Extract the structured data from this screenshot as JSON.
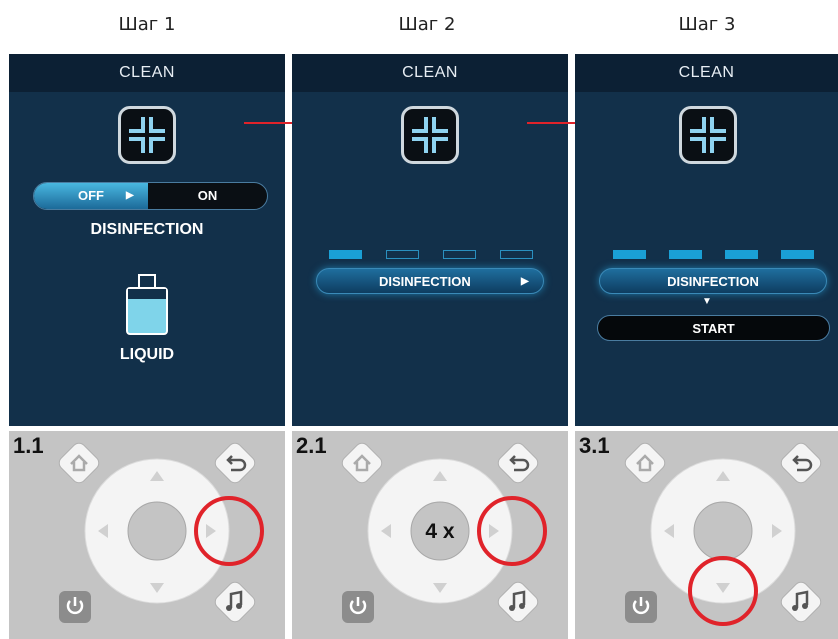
{
  "steps": [
    {
      "title": "Шаг 1",
      "screen_header": "CLEAN",
      "toggle": {
        "off_label": "OFF",
        "on_label": "ON"
      },
      "label_disinfection": "DISINFECTION",
      "label_liquid": "LIQUID",
      "remote_label": "1.1"
    },
    {
      "title": "Шаг 2",
      "screen_header": "CLEAN",
      "segments_filled": 1,
      "segments_total": 4,
      "pill_label": "DISINFECTION",
      "remote_label": "2.1",
      "center_text": "4 x"
    },
    {
      "title": "Шаг 3",
      "screen_header": "CLEAN",
      "segments_filled": 4,
      "segments_total": 4,
      "pill_label": "DISINFECTION",
      "start_label": "START",
      "remote_label": "3.1"
    }
  ],
  "colors": {
    "screen_bg": "#12304a",
    "accent_blue": "#1aa0d6",
    "highlight_red": "#e0232a",
    "remote_bg": "#c4c4c4"
  },
  "icons": [
    "clean-icon",
    "home-icon",
    "back-icon",
    "music-icon",
    "power-icon",
    "arrow-up-icon",
    "arrow-down-icon",
    "arrow-left-icon",
    "arrow-right-icon",
    "bottle-icon"
  ]
}
